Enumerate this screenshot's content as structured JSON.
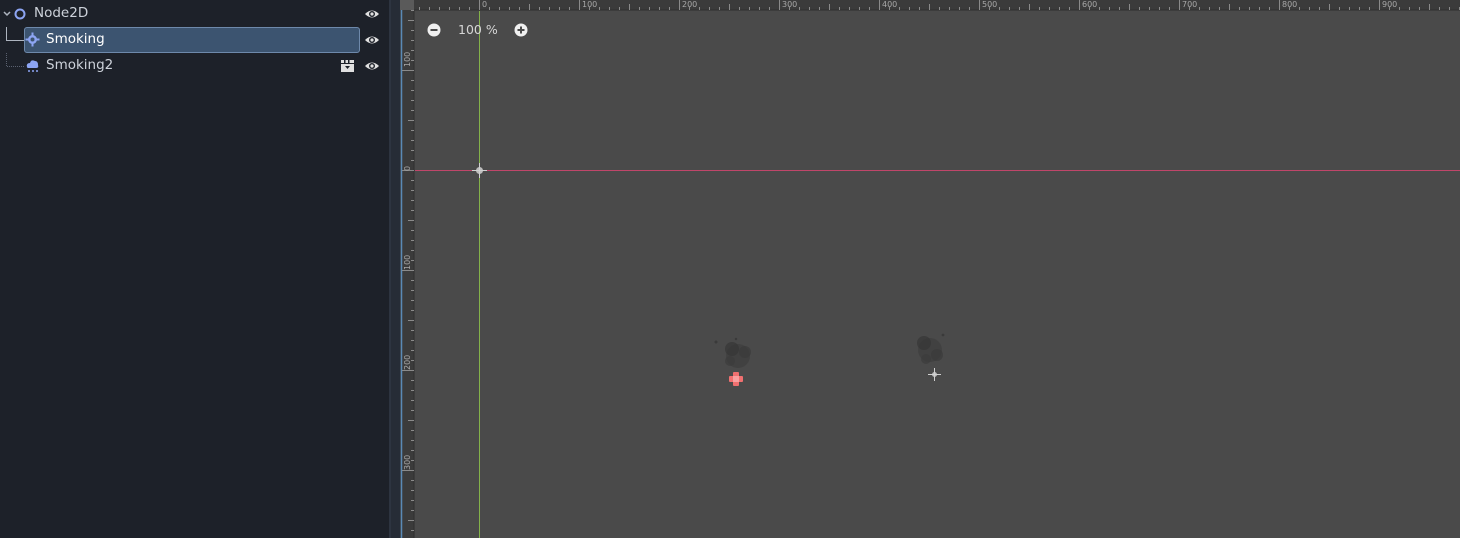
{
  "scene_tree": {
    "items": [
      {
        "label": "Node2D",
        "icon": "node2d-circle-icon",
        "expanded": true,
        "selected": false,
        "visible": true
      },
      {
        "label": "Smoking",
        "icon": "gpu-particles-2d-icon",
        "selected": true,
        "visible": true
      },
      {
        "label": "Smoking2",
        "icon": "cpu-particles-2d-icon",
        "selected": false,
        "visible": true,
        "has_scene_badge": true
      }
    ]
  },
  "viewport": {
    "zoom_label": "100 %",
    "ruler_x_ticks": [
      "0",
      "100",
      "200",
      "300",
      "400",
      "500",
      "600",
      "700",
      "800",
      "900"
    ],
    "ruler_y_ticks": [
      "100",
      "0",
      "100",
      "200",
      "300"
    ],
    "colors": {
      "background": "#4a4a4a",
      "x_axis": "#c0466a",
      "y_axis": "#84b24a",
      "panel": "#1d2129",
      "selection": "#3c5470",
      "selected_gizmo": "#f07070"
    }
  }
}
